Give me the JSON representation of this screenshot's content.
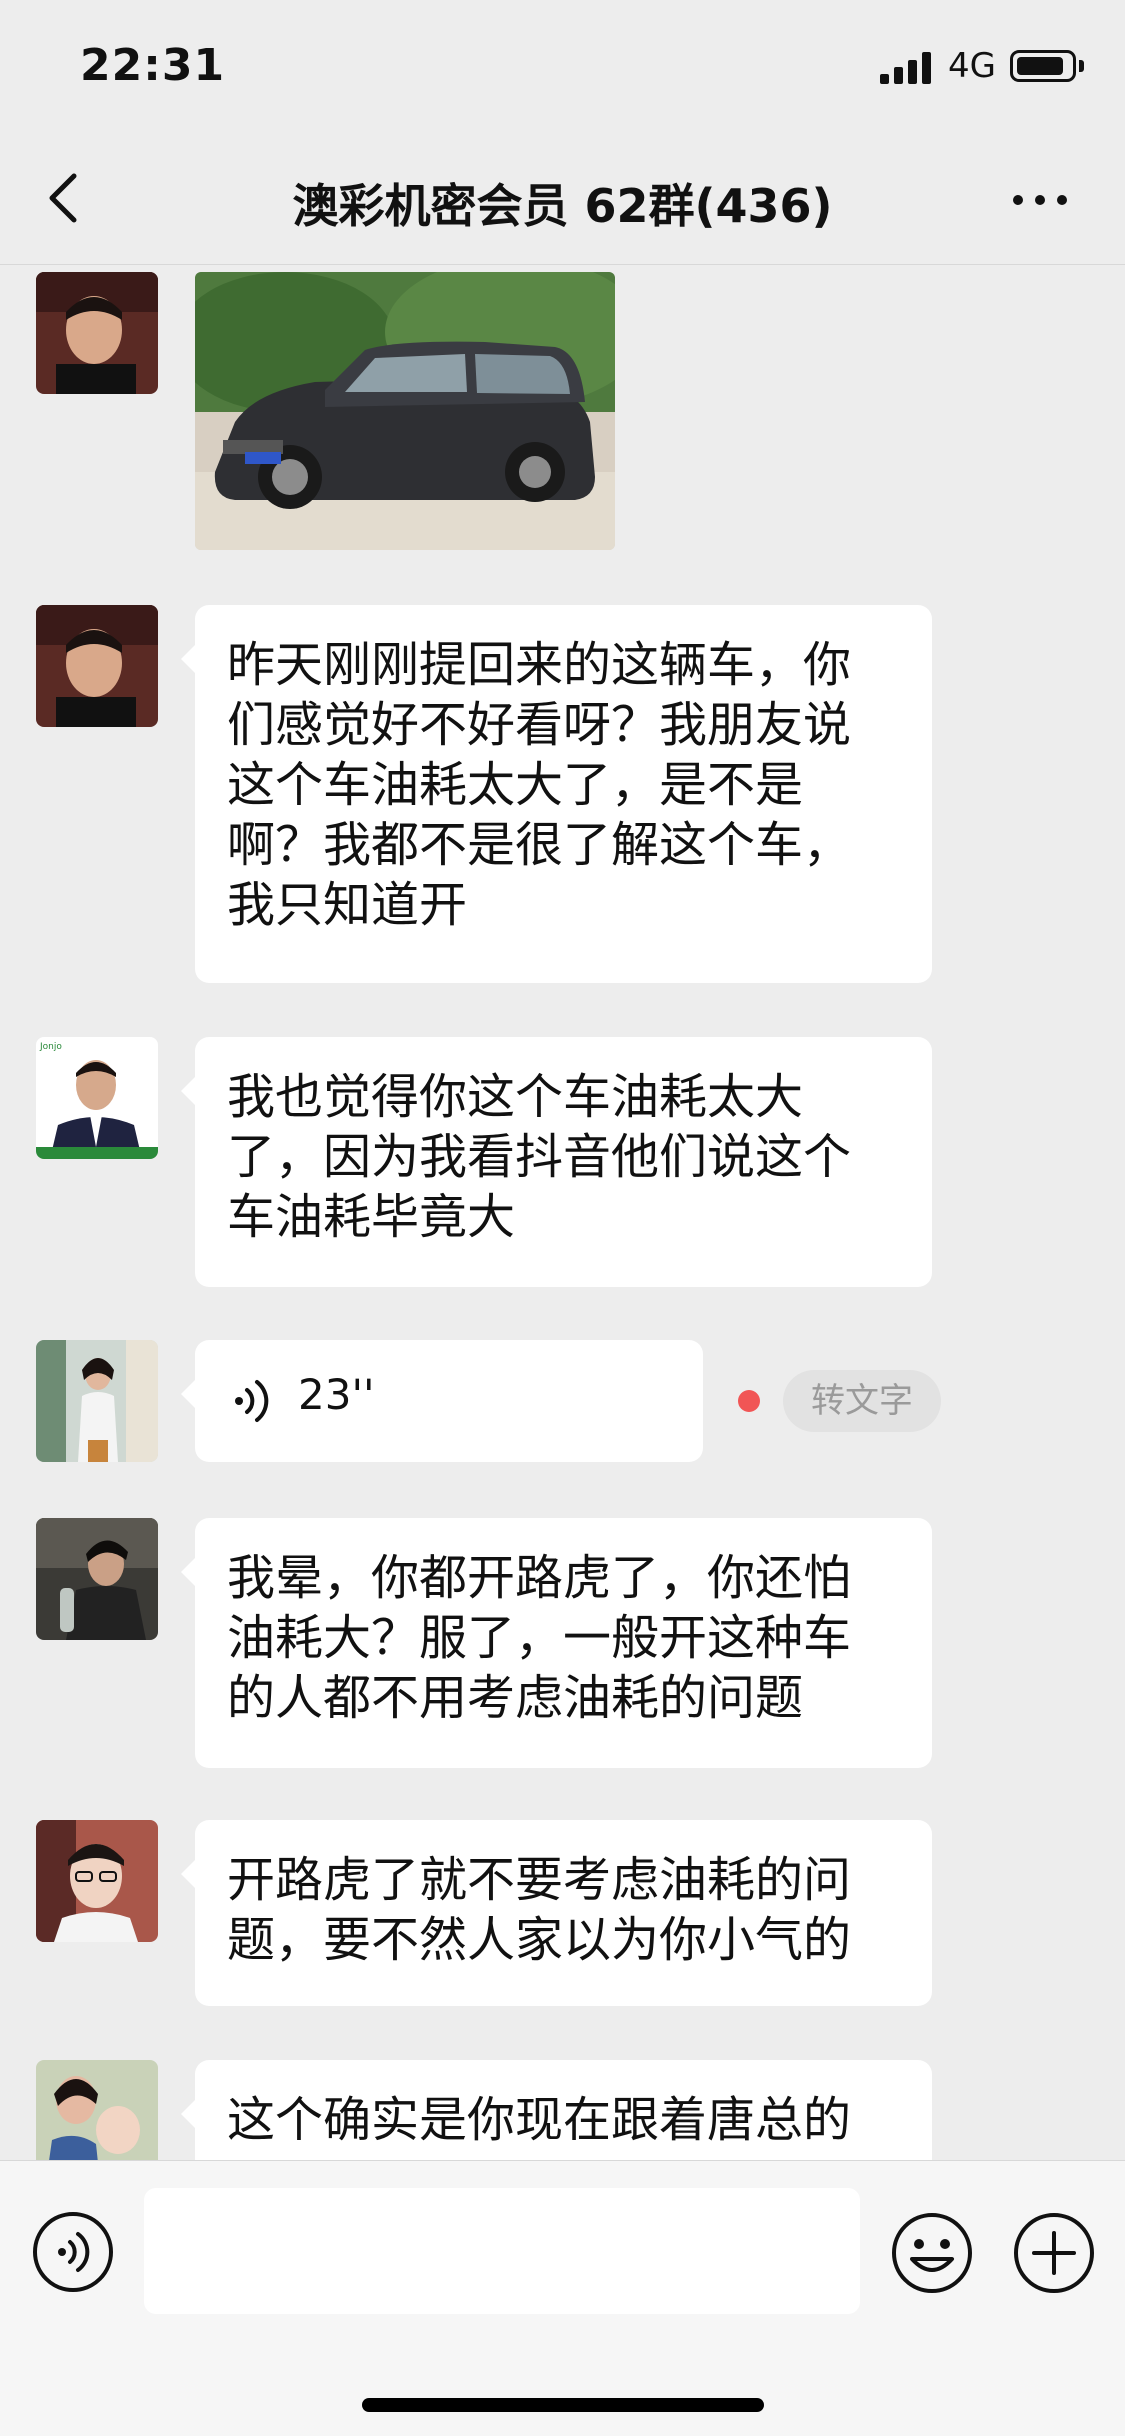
{
  "status_bar": {
    "time": "22:31",
    "network": "4G"
  },
  "header": {
    "title": "澳彩机密会员 62群(436)"
  },
  "messages": [
    {
      "type": "image",
      "description_icon": "car-photo"
    },
    {
      "type": "text",
      "lines": [
        "昨天刚刚提回来的这辆车，你",
        "们感觉好不好看呀？我朋友说",
        "这个车油耗太大了，是不是",
        "啊？我都不是很了解这个车，",
        "我只知道开"
      ]
    },
    {
      "type": "text",
      "lines": [
        "我也觉得你这个车油耗太大",
        "了，因为我看抖音他们说这个",
        "车油耗毕竟大"
      ]
    },
    {
      "type": "voice",
      "duration": "23''",
      "to_text_label": "转文字"
    },
    {
      "type": "text",
      "lines": [
        "我晕，你都开路虎了，你还怕",
        "油耗大？服了，一般开这种车",
        "的人都不用考虑油耗的问题"
      ]
    },
    {
      "type": "text",
      "lines": [
        "开路虎了就不要考虑油耗的问",
        "题，要不然人家以为你小气的"
      ]
    },
    {
      "type": "text",
      "lines": [
        "这个确实是你现在跟着唐总的",
        "……"
      ]
    }
  ],
  "input_bar": {
    "placeholder": ""
  },
  "colors": {
    "background": "#ededed",
    "bubble": "#ffffff",
    "unread": "#f15555"
  }
}
